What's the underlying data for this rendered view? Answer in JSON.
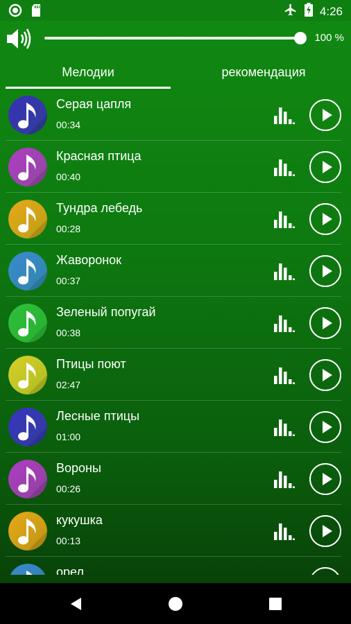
{
  "status_bar": {
    "left_icons": [
      "circle-notification-icon",
      "sd-card-icon"
    ],
    "right_icons": [
      "airplane-mode-icon",
      "battery-charging-icon"
    ],
    "time": "4:26"
  },
  "volume": {
    "icon": "speaker-volume-icon",
    "level": 1.0,
    "percent_label": "100 %"
  },
  "tabs": [
    {
      "label": "Мелодии",
      "selected": true
    },
    {
      "label": "рекомендация",
      "selected": false
    }
  ],
  "tracks": [
    {
      "title": "Серая цапля",
      "duration": "00:34",
      "color": "#3730b8"
    },
    {
      "title": "Красная птица",
      "duration": "00:40",
      "color": "#b03cc4"
    },
    {
      "title": "Тундра лебедь",
      "duration": "00:28",
      "color": "#e8a818"
    },
    {
      "title": "Жаворонок",
      "duration": "00:37",
      "color": "#3a8ad0"
    },
    {
      "title": "Зеленый попугай",
      "duration": "00:38",
      "color": "#2ec03a"
    },
    {
      "title": "Птицы поют",
      "duration": "02:47",
      "color": "#d8d028"
    },
    {
      "title": "Лесные птицы",
      "duration": "01:00",
      "color": "#3a34c0"
    },
    {
      "title": "Вороны",
      "duration": "00:26",
      "color": "#b03cc4"
    },
    {
      "title": "кукушка",
      "duration": "00:13",
      "color": "#e8a818"
    },
    {
      "title": "орел",
      "duration": "",
      "color": "#3a8ad0"
    }
  ],
  "nav_bar": {
    "icons": [
      "back-icon",
      "home-icon",
      "recents-icon"
    ]
  }
}
